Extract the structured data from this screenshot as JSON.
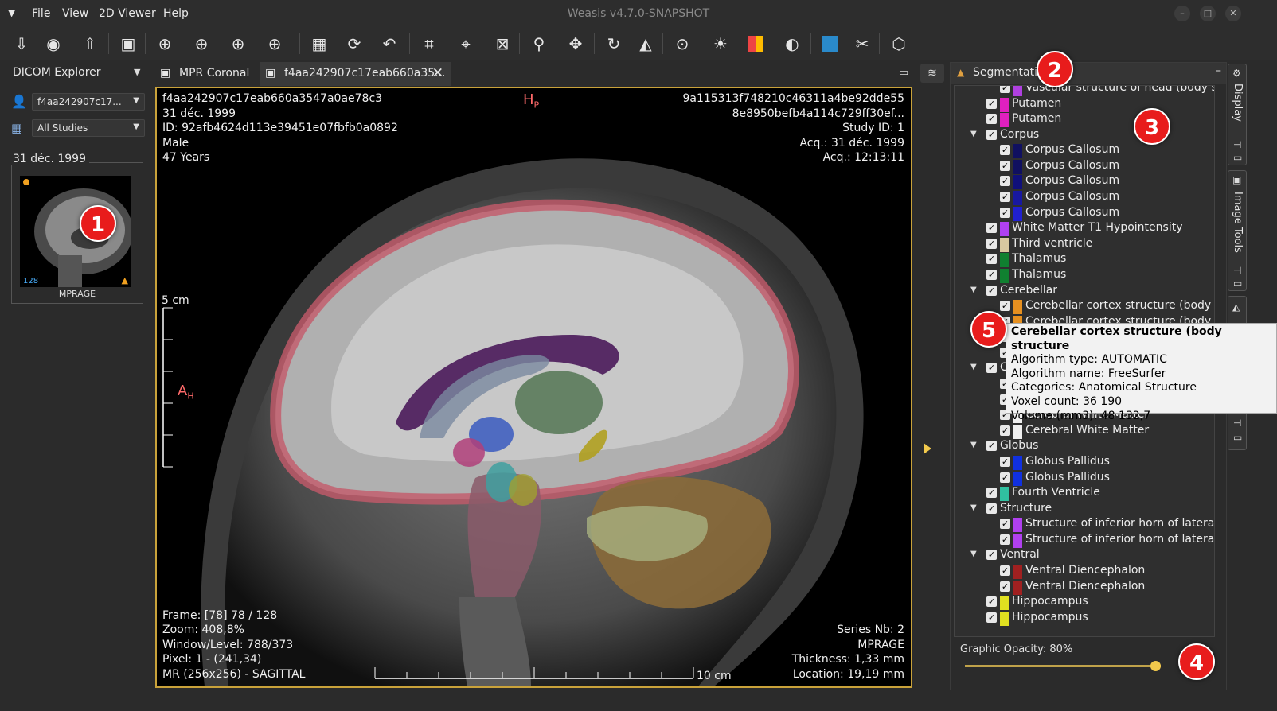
{
  "window": {
    "title": "Weasis v4.7.0-SNAPSHOT",
    "menu": [
      "File",
      "View",
      "2D Viewer",
      "Help"
    ]
  },
  "toolbar": {
    "icons": [
      "import-dicom-icon",
      "import-cd-icon",
      "export-dicom-icon",
      "export-image-icon",
      "mouse-left-icon",
      "mouse-middle-icon",
      "mouse-right-icon",
      "mouse-wheel-icon",
      "layout-icon",
      "synch-icon",
      "reset-icon",
      "crosshair-icon",
      "measure-icon",
      "clear-icon",
      "zoom-icon",
      "pan-icon",
      "rotate-icon",
      "flip-icon",
      "cine-icon",
      "presets-icon",
      "lut-icon",
      "invert-icon",
      "mpr-icon",
      "tools-icon",
      "3d-icon"
    ]
  },
  "explorer": {
    "title": "DICOM Explorer",
    "patient": "f4aa242907c17...",
    "studies": "All Studies",
    "study_date": "31 déc. 1999",
    "thumbnail": {
      "count": "128",
      "label": "MPRAGE"
    }
  },
  "tabs": [
    {
      "label": "MPR Coronal"
    },
    {
      "label": "f4aa242907c17eab660a35..."
    }
  ],
  "viewer": {
    "top_left": [
      "f4aa242907c17eab660a3547a0ae78c3",
      "31 déc. 1999",
      "ID: 92afb4624d113e39451e07fbfb0a0892",
      "Male",
      "47 Years"
    ],
    "top_right": [
      "9a115313f748210c46311a4be92dde55",
      "8e8950befb4a114c729ff30ef...",
      "Study ID: 1",
      "Acq.: 31 déc. 1999",
      "Acq.: 12:13:11"
    ],
    "bottom_left": [
      "Frame: [78] 78 / 128",
      "Zoom: 408,8%",
      "Window/Level: 788/373",
      "Pixel: 1 - (241,34)",
      "MR (256x256) - SAGITTAL"
    ],
    "bottom_right": [
      "Series Nb: 2",
      "MPRAGE",
      "Thickness: 1,33 mm",
      "Location: 19,19 mm"
    ],
    "orient_top": "H",
    "orient_top_sub": "P",
    "orient_left": "A",
    "orient_left_sub": "H",
    "scale_v": "5 cm",
    "scale_h": "10 cm"
  },
  "segmentation": {
    "title": "Segmentation",
    "rows": [
      {
        "label": "Vascular structure of head (body struc",
        "level": 1,
        "color": "#b040e0",
        "group": false
      },
      {
        "label": "Putamen",
        "level": 0,
        "color": "#e020c0",
        "group": false
      },
      {
        "label": "Putamen",
        "level": 0,
        "color": "#e020c0",
        "group": false
      },
      {
        "label": "Corpus",
        "level": 0,
        "color": "",
        "group": true
      },
      {
        "label": "Corpus Callosum",
        "level": 1,
        "color": "#101060",
        "group": false
      },
      {
        "label": "Corpus Callosum",
        "level": 1,
        "color": "#101060",
        "group": false
      },
      {
        "label": "Corpus Callosum",
        "level": 1,
        "color": "#10107a",
        "group": false
      },
      {
        "label": "Corpus Callosum",
        "level": 1,
        "color": "#1818a0",
        "group": false
      },
      {
        "label": "Corpus Callosum",
        "level": 1,
        "color": "#2020d0",
        "group": false
      },
      {
        "label": "White Matter T1 Hypointensity",
        "level": 0,
        "color": "#b040f0",
        "group": false
      },
      {
        "label": "Third ventricle",
        "level": 0,
        "color": "#d8c8a0",
        "group": false
      },
      {
        "label": "Thalamus",
        "level": 0,
        "color": "#108030",
        "group": false
      },
      {
        "label": "Thalamus",
        "level": 0,
        "color": "#108030",
        "group": false
      },
      {
        "label": "Cerebellar",
        "level": 0,
        "color": "",
        "group": true
      },
      {
        "label": "Cerebellar cortex structure (body stru",
        "level": 1,
        "color": "#e69020",
        "group": false
      },
      {
        "label": "Cerebellar cortex structure (body stru",
        "level": 1,
        "color": "#e69020",
        "group": false
      },
      {
        "label": "",
        "level": 1,
        "color": "",
        "group": false
      },
      {
        "label": "",
        "level": 1,
        "color": "",
        "group": false
      },
      {
        "label": "C",
        "level": 0,
        "color": "",
        "group": true
      },
      {
        "label": "",
        "level": 1,
        "color": "",
        "group": false
      },
      {
        "label": "",
        "level": 1,
        "color": "",
        "group": false
      },
      {
        "label": "Cerebral White Matter",
        "level": 1,
        "color": "#f0f0f0",
        "group": false
      },
      {
        "label": "Cerebral White Matter",
        "level": 1,
        "color": "#f0f0f0",
        "group": false
      },
      {
        "label": "Globus",
        "level": 0,
        "color": "",
        "group": true
      },
      {
        "label": "Globus Pallidus",
        "level": 1,
        "color": "#1030e0",
        "group": false
      },
      {
        "label": "Globus Pallidus",
        "level": 1,
        "color": "#1030e0",
        "group": false
      },
      {
        "label": "Fourth Ventricle",
        "level": 0,
        "color": "#30c0a0",
        "group": false
      },
      {
        "label": "Structure",
        "level": 0,
        "color": "",
        "group": true
      },
      {
        "label": "Structure of inferior horn of lateral ven",
        "level": 1,
        "color": "#b040f0",
        "group": false
      },
      {
        "label": "Structure of inferior horn of lateral ven",
        "level": 1,
        "color": "#b040f0",
        "group": false
      },
      {
        "label": "Ventral",
        "level": 0,
        "color": "",
        "group": true
      },
      {
        "label": "Ventral Diencephalon",
        "level": 1,
        "color": "#a02020",
        "group": false
      },
      {
        "label": "Ventral Diencephalon",
        "level": 1,
        "color": "#a02020",
        "group": false
      },
      {
        "label": "Hippocampus",
        "level": 0,
        "color": "#e0e020",
        "group": false
      },
      {
        "label": "Hippocampus",
        "level": 0,
        "color": "#e0e020",
        "group": false
      }
    ],
    "opacity_label": "Graphic Opacity: 80%",
    "opacity": 0.8
  },
  "tooltip": {
    "title": "Cerebellar cortex structure (body structure",
    "lines": [
      "Algorithm type: AUTOMATIC",
      "Algorithm name: FreeSurfer",
      "Categories: Anatomical Structure",
      "Voxel count: 36 190",
      "Volume (mm3): 48 132,7"
    ]
  },
  "side_tabs": [
    "Display",
    "Image Tools"
  ],
  "markers": [
    "1",
    "2",
    "3",
    "4",
    "5"
  ],
  "colors": {
    "accent": "#c9a23a",
    "marker": "#e81c1c",
    "orient": "#ff6a6a"
  }
}
